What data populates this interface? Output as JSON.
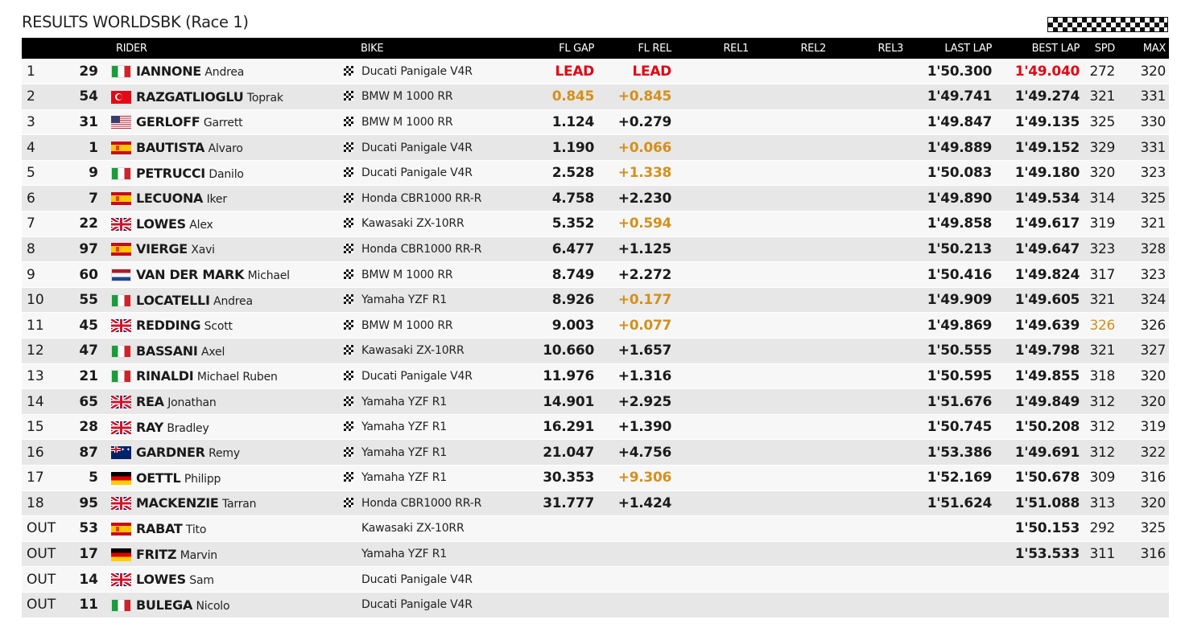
{
  "title": "RESULTS WORLDSBK (Race 1)",
  "colors": {
    "red": "#e30613",
    "orange": "#d4901c",
    "header_bg": "#000000",
    "row_odd": "#f7f7f7",
    "row_even": "#e7e7e7"
  },
  "columns": {
    "pos": "",
    "num": "",
    "rider": "RIDER",
    "bike": "BIKE",
    "fl_gap": "FL GAP",
    "fl_rel": "FL REL",
    "rel1": "REL1",
    "rel2": "REL2",
    "rel3": "REL3",
    "last_lap": "LAST LAP",
    "best_lap": "BEST LAP",
    "spd": "SPD",
    "max": "MAX"
  },
  "rows": [
    {
      "pos": "1",
      "num": "29",
      "flag": "it",
      "surname": "IANNONE",
      "firstname": "Andrea",
      "bike": "Ducati Panigale V4R",
      "checker": true,
      "fl_gap": "LEAD",
      "fl_gap_color": "red",
      "fl_rel": "LEAD",
      "fl_rel_color": "red",
      "rel1": "",
      "rel2": "",
      "rel3": "",
      "last_lap": "1'50.300",
      "best_lap": "1'49.040",
      "best_lap_color": "red",
      "spd": "272",
      "spd_color": "",
      "max": "320"
    },
    {
      "pos": "2",
      "num": "54",
      "flag": "tr",
      "surname": "RAZGATLIOGLU",
      "firstname": "Toprak",
      "bike": "BMW M 1000 RR",
      "checker": true,
      "fl_gap": "0.845",
      "fl_gap_color": "orange",
      "fl_rel": "+0.845",
      "fl_rel_color": "orange",
      "rel1": "",
      "rel2": "",
      "rel3": "",
      "last_lap": "1'49.741",
      "best_lap": "1'49.274",
      "best_lap_color": "",
      "spd": "321",
      "spd_color": "",
      "max": "331"
    },
    {
      "pos": "3",
      "num": "31",
      "flag": "us",
      "surname": "GERLOFF",
      "firstname": "Garrett",
      "bike": "BMW M 1000 RR",
      "checker": true,
      "fl_gap": "1.124",
      "fl_gap_color": "",
      "fl_rel": "+0.279",
      "fl_rel_color": "",
      "rel1": "",
      "rel2": "",
      "rel3": "",
      "last_lap": "1'49.847",
      "best_lap": "1'49.135",
      "best_lap_color": "",
      "spd": "325",
      "spd_color": "",
      "max": "330"
    },
    {
      "pos": "4",
      "num": "1",
      "flag": "es",
      "surname": "BAUTISTA",
      "firstname": "Alvaro",
      "bike": "Ducati Panigale V4R",
      "checker": true,
      "fl_gap": "1.190",
      "fl_gap_color": "",
      "fl_rel": "+0.066",
      "fl_rel_color": "orange",
      "rel1": "",
      "rel2": "",
      "rel3": "",
      "last_lap": "1'49.889",
      "best_lap": "1'49.152",
      "best_lap_color": "",
      "spd": "329",
      "spd_color": "",
      "max": "331"
    },
    {
      "pos": "5",
      "num": "9",
      "flag": "it",
      "surname": "PETRUCCI",
      "firstname": "Danilo",
      "bike": "Ducati Panigale V4R",
      "checker": true,
      "fl_gap": "2.528",
      "fl_gap_color": "",
      "fl_rel": "+1.338",
      "fl_rel_color": "orange",
      "rel1": "",
      "rel2": "",
      "rel3": "",
      "last_lap": "1'50.083",
      "best_lap": "1'49.180",
      "best_lap_color": "",
      "spd": "320",
      "spd_color": "",
      "max": "323"
    },
    {
      "pos": "6",
      "num": "7",
      "flag": "es",
      "surname": "LECUONA",
      "firstname": "Iker",
      "bike": "Honda CBR1000 RR-R",
      "checker": true,
      "fl_gap": "4.758",
      "fl_gap_color": "",
      "fl_rel": "+2.230",
      "fl_rel_color": "",
      "rel1": "",
      "rel2": "",
      "rel3": "",
      "last_lap": "1'49.890",
      "best_lap": "1'49.534",
      "best_lap_color": "",
      "spd": "314",
      "spd_color": "",
      "max": "325"
    },
    {
      "pos": "7",
      "num": "22",
      "flag": "gb",
      "surname": "LOWES",
      "firstname": "Alex",
      "bike": "Kawasaki ZX-10RR",
      "checker": true,
      "fl_gap": "5.352",
      "fl_gap_color": "",
      "fl_rel": "+0.594",
      "fl_rel_color": "orange",
      "rel1": "",
      "rel2": "",
      "rel3": "",
      "last_lap": "1'49.858",
      "best_lap": "1'49.617",
      "best_lap_color": "",
      "spd": "319",
      "spd_color": "",
      "max": "321"
    },
    {
      "pos": "8",
      "num": "97",
      "flag": "es",
      "surname": "VIERGE",
      "firstname": "Xavi",
      "bike": "Honda CBR1000 RR-R",
      "checker": true,
      "fl_gap": "6.477",
      "fl_gap_color": "",
      "fl_rel": "+1.125",
      "fl_rel_color": "",
      "rel1": "",
      "rel2": "",
      "rel3": "",
      "last_lap": "1'50.213",
      "best_lap": "1'49.647",
      "best_lap_color": "",
      "spd": "323",
      "spd_color": "",
      "max": "328"
    },
    {
      "pos": "9",
      "num": "60",
      "flag": "nl",
      "surname": "VAN DER MARK",
      "firstname": "Michael",
      "bike": "BMW M 1000 RR",
      "checker": true,
      "fl_gap": "8.749",
      "fl_gap_color": "",
      "fl_rel": "+2.272",
      "fl_rel_color": "",
      "rel1": "",
      "rel2": "",
      "rel3": "",
      "last_lap": "1'50.416",
      "best_lap": "1'49.824",
      "best_lap_color": "",
      "spd": "317",
      "spd_color": "",
      "max": "323"
    },
    {
      "pos": "10",
      "num": "55",
      "flag": "it",
      "surname": "LOCATELLI",
      "firstname": "Andrea",
      "bike": "Yamaha YZF R1",
      "checker": true,
      "fl_gap": "8.926",
      "fl_gap_color": "",
      "fl_rel": "+0.177",
      "fl_rel_color": "orange",
      "rel1": "",
      "rel2": "",
      "rel3": "",
      "last_lap": "1'49.909",
      "best_lap": "1'49.605",
      "best_lap_color": "",
      "spd": "321",
      "spd_color": "",
      "max": "324"
    },
    {
      "pos": "11",
      "num": "45",
      "flag": "gb",
      "surname": "REDDING",
      "firstname": "Scott",
      "bike": "BMW M 1000 RR",
      "checker": true,
      "fl_gap": "9.003",
      "fl_gap_color": "",
      "fl_rel": "+0.077",
      "fl_rel_color": "orange",
      "rel1": "",
      "rel2": "",
      "rel3": "",
      "last_lap": "1'49.869",
      "best_lap": "1'49.639",
      "best_lap_color": "",
      "spd": "326",
      "spd_color": "orange",
      "max": "326"
    },
    {
      "pos": "12",
      "num": "47",
      "flag": "it",
      "surname": "BASSANI",
      "firstname": "Axel",
      "bike": "Kawasaki ZX-10RR",
      "checker": true,
      "fl_gap": "10.660",
      "fl_gap_color": "",
      "fl_rel": "+1.657",
      "fl_rel_color": "",
      "rel1": "",
      "rel2": "",
      "rel3": "",
      "last_lap": "1'50.555",
      "best_lap": "1'49.798",
      "best_lap_color": "",
      "spd": "321",
      "spd_color": "",
      "max": "327"
    },
    {
      "pos": "13",
      "num": "21",
      "flag": "it",
      "surname": "RINALDI",
      "firstname": "Michael Ruben",
      "bike": "Ducati Panigale V4R",
      "checker": true,
      "fl_gap": "11.976",
      "fl_gap_color": "",
      "fl_rel": "+1.316",
      "fl_rel_color": "",
      "rel1": "",
      "rel2": "",
      "rel3": "",
      "last_lap": "1'50.595",
      "best_lap": "1'49.855",
      "best_lap_color": "",
      "spd": "318",
      "spd_color": "",
      "max": "320"
    },
    {
      "pos": "14",
      "num": "65",
      "flag": "gb",
      "surname": "REA",
      "firstname": "Jonathan",
      "bike": "Yamaha YZF R1",
      "checker": true,
      "fl_gap": "14.901",
      "fl_gap_color": "",
      "fl_rel": "+2.925",
      "fl_rel_color": "",
      "rel1": "",
      "rel2": "",
      "rel3": "",
      "last_lap": "1'51.676",
      "best_lap": "1'49.849",
      "best_lap_color": "",
      "spd": "312",
      "spd_color": "",
      "max": "320"
    },
    {
      "pos": "15",
      "num": "28",
      "flag": "gb",
      "surname": "RAY",
      "firstname": "Bradley",
      "bike": "Yamaha YZF R1",
      "checker": true,
      "fl_gap": "16.291",
      "fl_gap_color": "",
      "fl_rel": "+1.390",
      "fl_rel_color": "",
      "rel1": "",
      "rel2": "",
      "rel3": "",
      "last_lap": "1'50.745",
      "best_lap": "1'50.208",
      "best_lap_color": "",
      "spd": "312",
      "spd_color": "",
      "max": "319"
    },
    {
      "pos": "16",
      "num": "87",
      "flag": "au",
      "surname": "GARDNER",
      "firstname": "Remy",
      "bike": "Yamaha YZF R1",
      "checker": true,
      "fl_gap": "21.047",
      "fl_gap_color": "",
      "fl_rel": "+4.756",
      "fl_rel_color": "",
      "rel1": "",
      "rel2": "",
      "rel3": "",
      "last_lap": "1'53.386",
      "best_lap": "1'49.691",
      "best_lap_color": "",
      "spd": "312",
      "spd_color": "",
      "max": "322"
    },
    {
      "pos": "17",
      "num": "5",
      "flag": "de",
      "surname": "OETTL",
      "firstname": "Philipp",
      "bike": "Yamaha YZF R1",
      "checker": true,
      "fl_gap": "30.353",
      "fl_gap_color": "",
      "fl_rel": "+9.306",
      "fl_rel_color": "orange",
      "rel1": "",
      "rel2": "",
      "rel3": "",
      "last_lap": "1'52.169",
      "best_lap": "1'50.678",
      "best_lap_color": "",
      "spd": "309",
      "spd_color": "",
      "max": "316"
    },
    {
      "pos": "18",
      "num": "95",
      "flag": "gb",
      "surname": "MACKENZIE",
      "firstname": "Tarran",
      "bike": "Honda CBR1000 RR-R",
      "checker": true,
      "fl_gap": "31.777",
      "fl_gap_color": "",
      "fl_rel": "+1.424",
      "fl_rel_color": "",
      "rel1": "",
      "rel2": "",
      "rel3": "",
      "last_lap": "1'51.624",
      "best_lap": "1'51.088",
      "best_lap_color": "",
      "spd": "313",
      "spd_color": "",
      "max": "320"
    },
    {
      "pos": "OUT",
      "num": "53",
      "flag": "es",
      "surname": "RABAT",
      "firstname": "Tito",
      "bike": "Kawasaki ZX-10RR",
      "checker": false,
      "fl_gap": "",
      "fl_gap_color": "",
      "fl_rel": "",
      "fl_rel_color": "",
      "rel1": "",
      "rel2": "",
      "rel3": "",
      "last_lap": "",
      "best_lap": "1'50.153",
      "best_lap_color": "",
      "spd": "292",
      "spd_color": "",
      "max": "325"
    },
    {
      "pos": "OUT",
      "num": "17",
      "flag": "de",
      "surname": "FRITZ",
      "firstname": "Marvin",
      "bike": "Yamaha YZF R1",
      "checker": false,
      "fl_gap": "",
      "fl_gap_color": "",
      "fl_rel": "",
      "fl_rel_color": "",
      "rel1": "",
      "rel2": "",
      "rel3": "",
      "last_lap": "",
      "best_lap": "1'53.533",
      "best_lap_color": "",
      "spd": "311",
      "spd_color": "",
      "max": "316"
    },
    {
      "pos": "OUT",
      "num": "14",
      "flag": "gb",
      "surname": "LOWES",
      "firstname": "Sam",
      "bike": "Ducati Panigale V4R",
      "checker": false,
      "fl_gap": "",
      "fl_gap_color": "",
      "fl_rel": "",
      "fl_rel_color": "",
      "rel1": "",
      "rel2": "",
      "rel3": "",
      "last_lap": "",
      "best_lap": "",
      "best_lap_color": "",
      "spd": "",
      "spd_color": "",
      "max": ""
    },
    {
      "pos": "OUT",
      "num": "11",
      "flag": "it",
      "surname": "BULEGA",
      "firstname": "Nicolo",
      "bike": "Ducati Panigale V4R",
      "checker": false,
      "fl_gap": "",
      "fl_gap_color": "",
      "fl_rel": "",
      "fl_rel_color": "",
      "rel1": "",
      "rel2": "",
      "rel3": "",
      "last_lap": "",
      "best_lap": "",
      "best_lap_color": "",
      "spd": "",
      "spd_color": "",
      "max": ""
    }
  ]
}
